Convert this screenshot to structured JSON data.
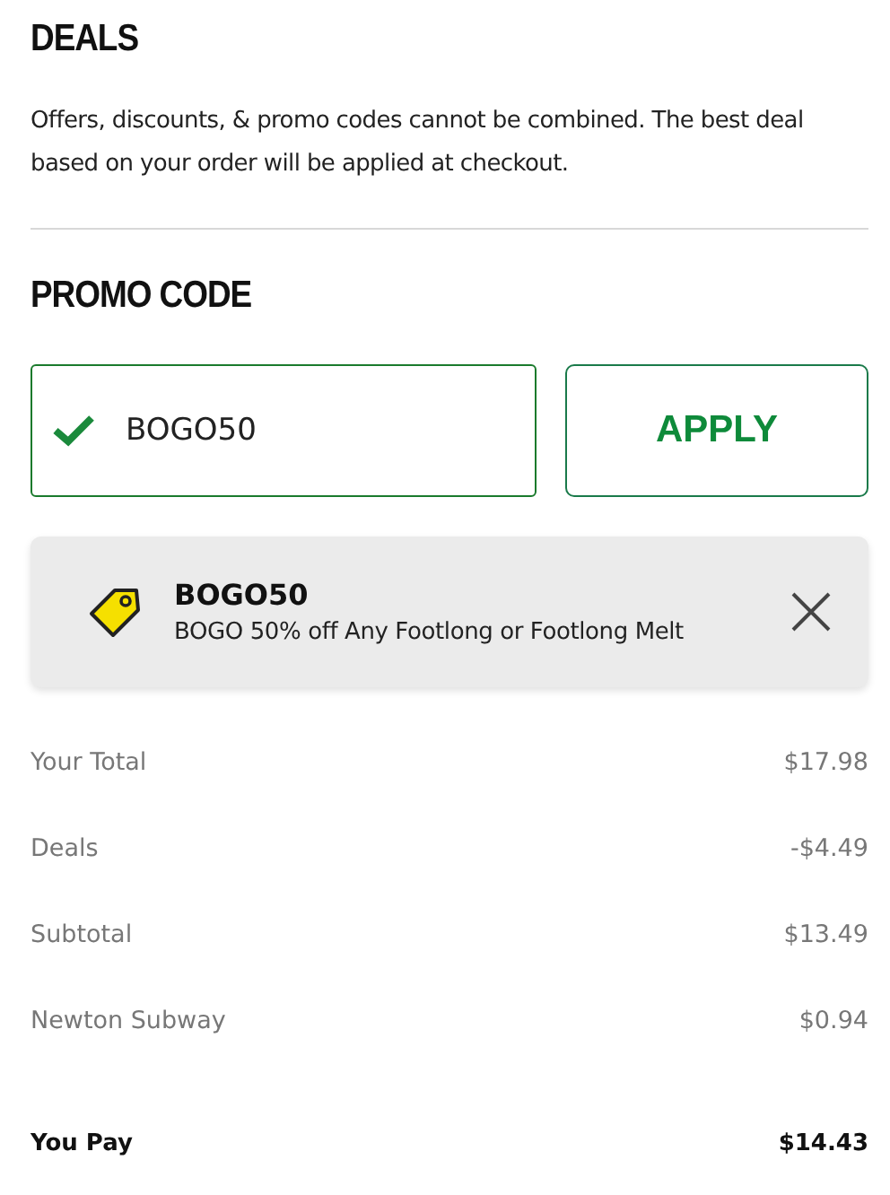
{
  "deals": {
    "title": "DEALS",
    "note": "Offers, discounts, & promo codes cannot be combined. The best deal based on your order will be applied at checkout."
  },
  "promo": {
    "title": "PROMO CODE",
    "field": {
      "value": "BOGO50",
      "valid": true
    },
    "button": "APPLY"
  },
  "applied_deal": {
    "code": "BOGO50",
    "description": "BOGO 50% off Any Footlong or Footlong Melt"
  },
  "totals": [
    {
      "kind": "line",
      "label": "Your Total",
      "amount": "$17.98"
    },
    {
      "kind": "line",
      "label": "Deals",
      "amount": "-$4.49"
    },
    {
      "kind": "line",
      "label": "Subtotal",
      "amount": "$13.49"
    },
    {
      "kind": "line",
      "label": "Newton Subway",
      "amount": "$0.94"
    },
    {
      "kind": "total",
      "label": "You Pay",
      "amount": "$14.43"
    }
  ]
}
